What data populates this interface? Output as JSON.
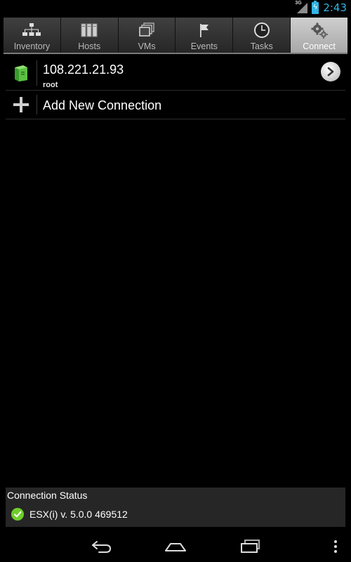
{
  "status_bar": {
    "network_label": "3G",
    "time": "2:43",
    "accent_color": "#33b5e5"
  },
  "tabs": [
    {
      "label": "Inventory",
      "icon": "inventory-tree-icon",
      "active": false
    },
    {
      "label": "Hosts",
      "icon": "hosts-servers-icon",
      "active": false
    },
    {
      "label": "VMs",
      "icon": "vms-stack-icon",
      "active": false
    },
    {
      "label": "Events",
      "icon": "flag-icon",
      "active": false
    },
    {
      "label": "Tasks",
      "icon": "clock-icon",
      "active": false
    },
    {
      "label": "Connect",
      "icon": "gears-icon",
      "active": true
    }
  ],
  "connections": [
    {
      "host": "108.221.21.93",
      "user": "root",
      "icon": "server-green-icon"
    }
  ],
  "add_connection": {
    "label": "Add New Connection",
    "icon": "plus-icon"
  },
  "connection_status": {
    "header": "Connection Status",
    "value": "ESX(i) v. 5.0.0 469512",
    "ok_color": "#6fce2b"
  },
  "nav_bar": {
    "icons": [
      "back-icon",
      "home-icon",
      "recent-apps-icon",
      "menu-overflow-icon"
    ]
  }
}
